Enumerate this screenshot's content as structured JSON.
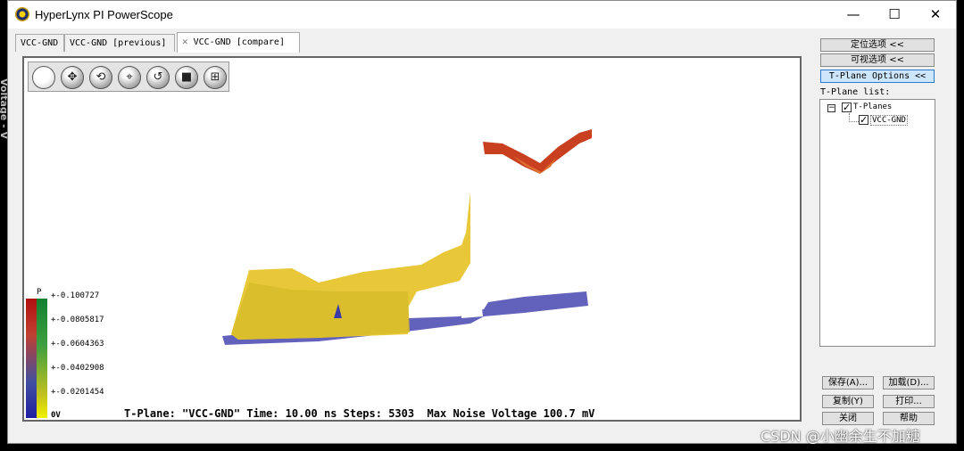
{
  "window": {
    "title": "HyperLynx PI PowerScope",
    "minimize": "—",
    "maximize": "☐",
    "close": "✕"
  },
  "background": {
    "y_axis_label": "Voltage - V"
  },
  "tabs": [
    {
      "label": "VCC-GND"
    },
    {
      "label": "VCC-GND [previous]"
    },
    {
      "label": "VCC-GND [compare]",
      "close": "✕",
      "active": true
    }
  ],
  "toolbar": {
    "icons": [
      "circle-icon",
      "pan-icon",
      "rotate-icon",
      "zoom-icon",
      "reset-icon",
      "stop-icon",
      "fit-icon"
    ],
    "glyphs": [
      "",
      "✥",
      "⟲",
      "⌖",
      "↺",
      "■",
      "⊞"
    ]
  },
  "legend": {
    "header_left": "P",
    "labels": [
      "+-0.100727",
      "+-0.0805817",
      "+-0.0604363",
      "+-0.0402908",
      "+-0.0201454",
      "0V"
    ],
    "colors": [
      "#b01010",
      "#d06020",
      "#c0a020",
      "#3050b0",
      "#2020a0",
      "#f0f000"
    ]
  },
  "status": {
    "text": "T-Plane: \"VCC-GND\" Time: 10.00 ns Steps: 5303  Max Noise Voltage 100.7 mV"
  },
  "options": {
    "positioning": "定位选项 <<",
    "visual": "可视选项 <<",
    "tplane": "T-Plane Options <<",
    "tplane_list_label": "T-Plane list:",
    "tree_root": "T-Planes",
    "tree_child": "VCC-GND",
    "tree_expander": "−"
  },
  "buttons": {
    "save": "保存(A)...",
    "load": "加载(D)...",
    "copy": "复制(Y)",
    "print": "打印...",
    "close": "关闭",
    "help": "帮助"
  },
  "watermark": "CSDN @小幽余生不加糖"
}
